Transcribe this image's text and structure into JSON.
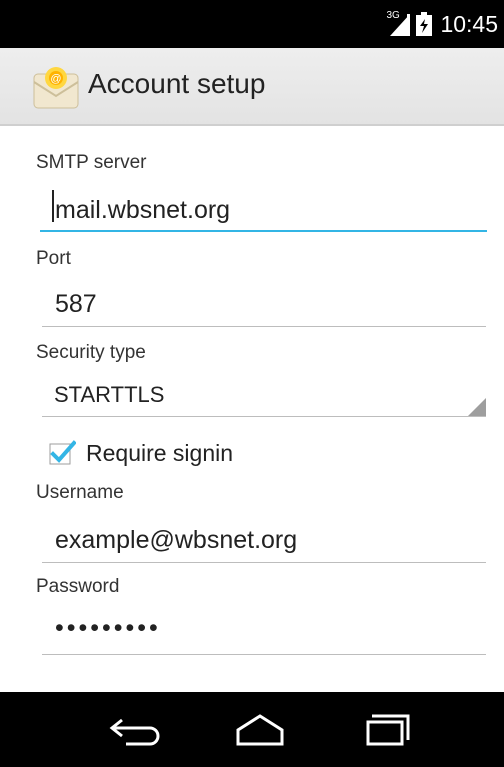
{
  "status_bar": {
    "network": "3G",
    "time": "10:45"
  },
  "header": {
    "title": "Account setup",
    "icon": "email-app-icon"
  },
  "form": {
    "smtp_label": "SMTP server",
    "smtp_value": "mail.wbsnet.org",
    "port_label": "Port",
    "port_value": "587",
    "security_label": "Security type",
    "security_value": "STARTTLS",
    "require_signin_label": "Require signin",
    "require_signin_checked": true,
    "username_label": "Username",
    "username_value": "example@wbsnet.org",
    "password_label": "Password",
    "password_value": "•••••••••"
  },
  "nav": {
    "icons": [
      "back-icon",
      "home-icon",
      "recent-apps-icon"
    ]
  },
  "colors": {
    "accent": "#33b5e5",
    "status_bar": "#000000",
    "nav_bar": "#000000"
  }
}
